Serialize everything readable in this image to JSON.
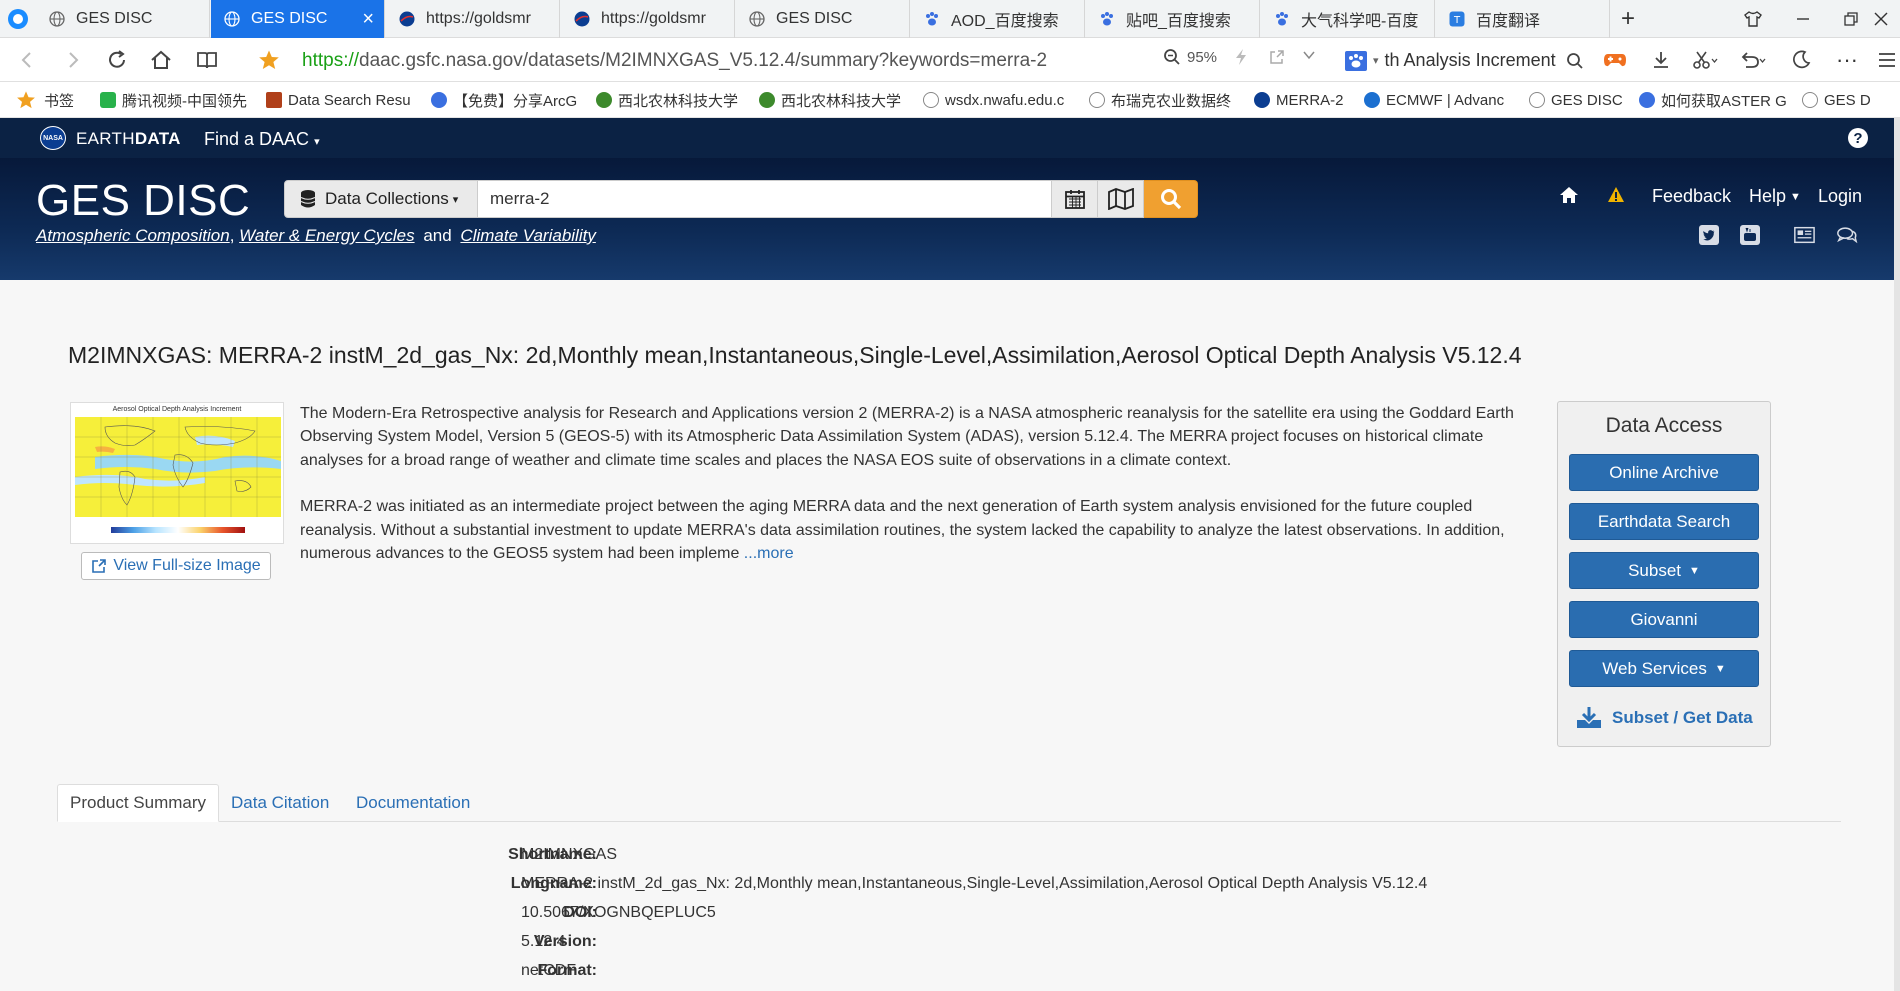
{
  "browser": {
    "tabs": [
      {
        "label": "GES DISC",
        "icon": "globe-icon",
        "active": false
      },
      {
        "label": "GES DISC",
        "icon": "globe-icon",
        "active": true
      },
      {
        "label": "https://goldsmr",
        "icon": "nasa-icon",
        "active": false
      },
      {
        "label": "https://goldsmr",
        "icon": "nasa-icon",
        "active": false
      },
      {
        "label": "GES DISC",
        "icon": "globe-icon",
        "active": false
      },
      {
        "label": "AOD_百度搜索",
        "icon": "baidu-paw-icon",
        "active": false
      },
      {
        "label": "贴吧_百度搜索",
        "icon": "baidu-paw-icon",
        "active": false
      },
      {
        "label": "大气科学吧-百度",
        "icon": "baidu-paw-icon",
        "active": false
      },
      {
        "label": "百度翻译",
        "icon": "translate-icon",
        "active": false
      }
    ],
    "url_protocol": "https://",
    "url_rest": "daac.gsfc.nasa.gov/datasets/M2IMNXGAS_V5.12.4/summary?keywords=merra-2",
    "zoom": "95%",
    "search_text": "th Analysis Increment",
    "bookmarks": [
      {
        "label": "书签",
        "color": "#f0a020"
      },
      {
        "label": "腾讯视频-中国领先",
        "color": "#28b24b"
      },
      {
        "label": "Data Search Resu",
        "color": "#b0401a"
      },
      {
        "label": "【免费】分享ArcG",
        "color": "#3a6fe0"
      },
      {
        "label": "西北农林科技大学",
        "color": "#3d8a2c"
      },
      {
        "label": "西北农林科技大学",
        "color": "#3d8a2c"
      },
      {
        "label": "wsdx.nwafu.edu.c",
        "color": "#888888"
      },
      {
        "label": "布瑞克农业数据终",
        "color": "#888888"
      },
      {
        "label": "MERRA-2",
        "color": "#0b3d91"
      },
      {
        "label": "ECMWF | Advanc",
        "color": "#1b6fd0"
      },
      {
        "label": "GES DISC",
        "color": "#888888"
      },
      {
        "label": "如何获取ASTER G",
        "color": "#3a6fe0"
      },
      {
        "label": "GES D",
        "color": "#888888"
      }
    ]
  },
  "earthdata": {
    "logo_text": "NASA",
    "name_thin": "EARTH",
    "name_bold": "DATA",
    "find_daac": "Find a DAAC"
  },
  "header": {
    "title": "GES DISC",
    "sub_link1": "Atmospheric Composition",
    "sub_link2": "Water & Energy Cycles",
    "sub_and": "and",
    "sub_link3": "Climate Variability",
    "collection_dropdown": "Data Collections",
    "search_value": "merra-2",
    "feedback": "Feedback",
    "help": "Help",
    "login": "Login"
  },
  "dataset": {
    "title": "M2IMNXGAS: MERRA-2 instM_2d_gas_Nx: 2d,Monthly mean,Instantaneous,Single-Level,Assimilation,Aerosol Optical Depth Analysis V5.12.4",
    "thumb_title": "Aerosol Optical Depth Analysis Increment",
    "view_full_image": "View Full-size Image",
    "description_p1": "The Modern-Era Retrospective analysis for Research and Applications version 2 (MERRA-2) is a NASA atmospheric reanalysis for the satellite era using the Goddard Earth Observing System Model, Version 5 (GEOS-5) with its Atmospheric Data Assimilation System (ADAS), version 5.12.4. The MERRA project focuses on historical climate analyses for a broad range of weather and climate time scales and places the NASA EOS suite of observations in a climate context.",
    "description_p2": "MERRA-2 was initiated as an intermediate project between the aging MERRA data and the next generation of Earth system analysis envisioned for the future coupled reanalysis. Without a substantial investment to update MERRA's data assimilation routines, the system lacked the capability to analyze the latest observations. In addition, numerous advances to the GEOS5 system had been impleme",
    "more_link": "...more"
  },
  "data_access": {
    "title": "Data Access",
    "buttons": [
      {
        "label": "Online Archive",
        "caret": false
      },
      {
        "label": "Earthdata Search",
        "caret": false
      },
      {
        "label": "Subset",
        "caret": true
      },
      {
        "label": "Giovanni",
        "caret": false
      },
      {
        "label": "Web Services",
        "caret": true
      }
    ],
    "get_data": "Subset / Get Data"
  },
  "tabs": [
    {
      "label": "Product Summary",
      "active": true
    },
    {
      "label": "Data Citation",
      "active": false
    },
    {
      "label": "Documentation",
      "active": false
    }
  ],
  "summary": [
    {
      "key": "Shortname:",
      "value": "M2IMNXGAS"
    },
    {
      "key": "Longname:",
      "value": "MERRA-2 instM_2d_gas_Nx: 2d,Monthly mean,Instantaneous,Single-Level,Assimilation,Aerosol Optical Depth Analysis V5.12.4"
    },
    {
      "key": "DOI:",
      "value": "10.5067/XOGNBQEPLUC5"
    },
    {
      "key": "Version:",
      "value": "5.12.4"
    },
    {
      "key": "Format:",
      "value": "netCDF"
    }
  ],
  "colors": {
    "active_tab": "#1a73e8",
    "header_bg": "#0b2244",
    "accent_orange": "#f0a030",
    "access_button": "#2a6db0",
    "link": "#2a6fb5"
  }
}
